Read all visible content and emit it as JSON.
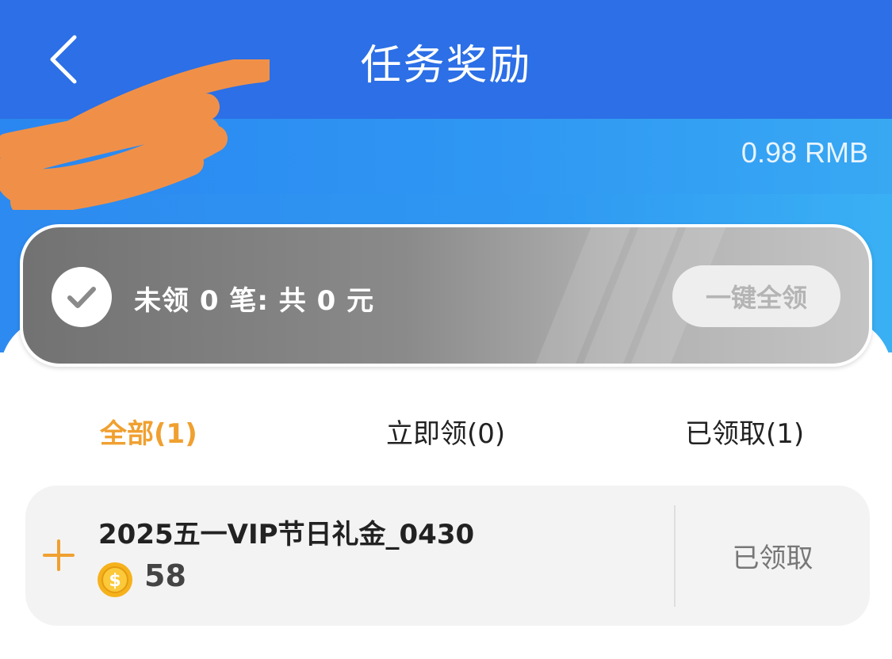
{
  "header": {
    "back_icon": "chevron-left-icon",
    "title": "任务奖励"
  },
  "balance": {
    "amount_text": "0.98 RMB"
  },
  "summary": {
    "check_icon": "check-circle-icon",
    "text": "未领 0 笔: 共 0 元",
    "claim_all_label": "一键全领"
  },
  "tabs": [
    {
      "label": "全部(1)",
      "active": true
    },
    {
      "label": "立即领(0)",
      "active": false
    },
    {
      "label": "已领取(1)",
      "active": false
    }
  ],
  "rewards": [
    {
      "title": "2025五一VIP节日礼金_0430",
      "amount": "58",
      "coin_icon": "gold-coin-icon",
      "expand_icon": "plus-icon",
      "status": "已领取"
    }
  ],
  "colors": {
    "header_blue": "#2c6fe6",
    "accent_orange": "#f0a030",
    "redaction_orange": "#f09048"
  }
}
